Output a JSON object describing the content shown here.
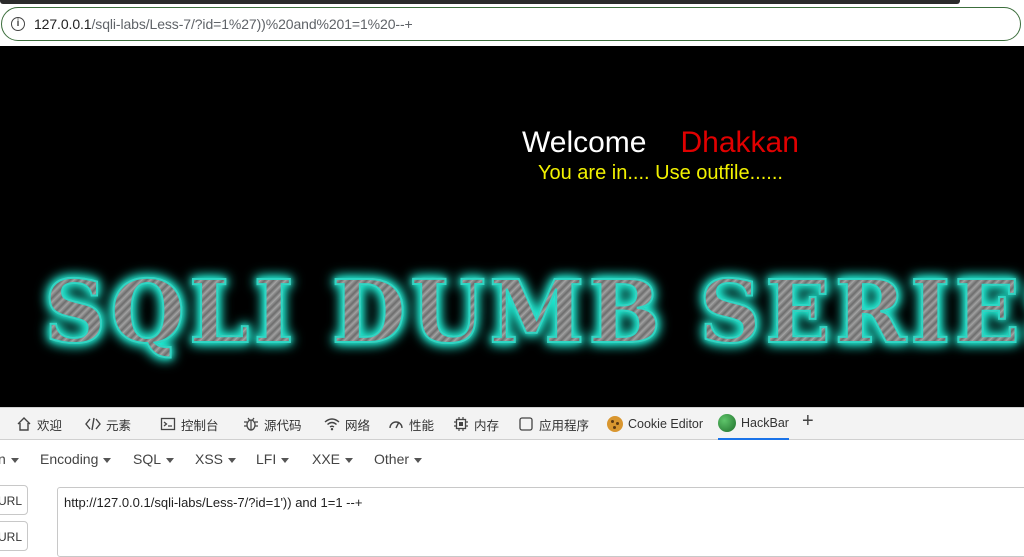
{
  "browser": {
    "address_host": "127.0.0.1",
    "address_path": "/sqli-labs/Less-7/?id=1%27))%20and%201=1%20--+"
  },
  "page": {
    "welcome": "Welcome",
    "name": "Dhakkan",
    "message": "You are in.... Use outfile......",
    "banner": "SQLI DUMB SERIES"
  },
  "devtools": {
    "tabs": [
      {
        "label": "欢迎",
        "icon": "home-icon"
      },
      {
        "label": "元素",
        "icon": "code-icon"
      },
      {
        "label": "控制台",
        "icon": "console-icon"
      },
      {
        "label": "源代码",
        "icon": "bug-icon"
      },
      {
        "label": "网络",
        "icon": "wifi-icon"
      },
      {
        "label": "性能",
        "icon": "gauge-icon"
      },
      {
        "label": "内存",
        "icon": "chip-icon"
      },
      {
        "label": "应用程序",
        "icon": "app-icon"
      },
      {
        "label": "Cookie Editor",
        "icon": "cookie-icon"
      },
      {
        "label": "HackBar",
        "icon": "hackbar-icon"
      }
    ],
    "active_tab": "HackBar"
  },
  "hackbar": {
    "menu": [
      "n",
      "Encoding",
      "SQL",
      "XSS",
      "LFI",
      "XXE",
      "Other"
    ],
    "buttons": [
      "URL",
      "URL"
    ],
    "url_value": "http://127.0.0.1/sqli-labs/Less-7/?id=1')) and 1=1 --+"
  }
}
